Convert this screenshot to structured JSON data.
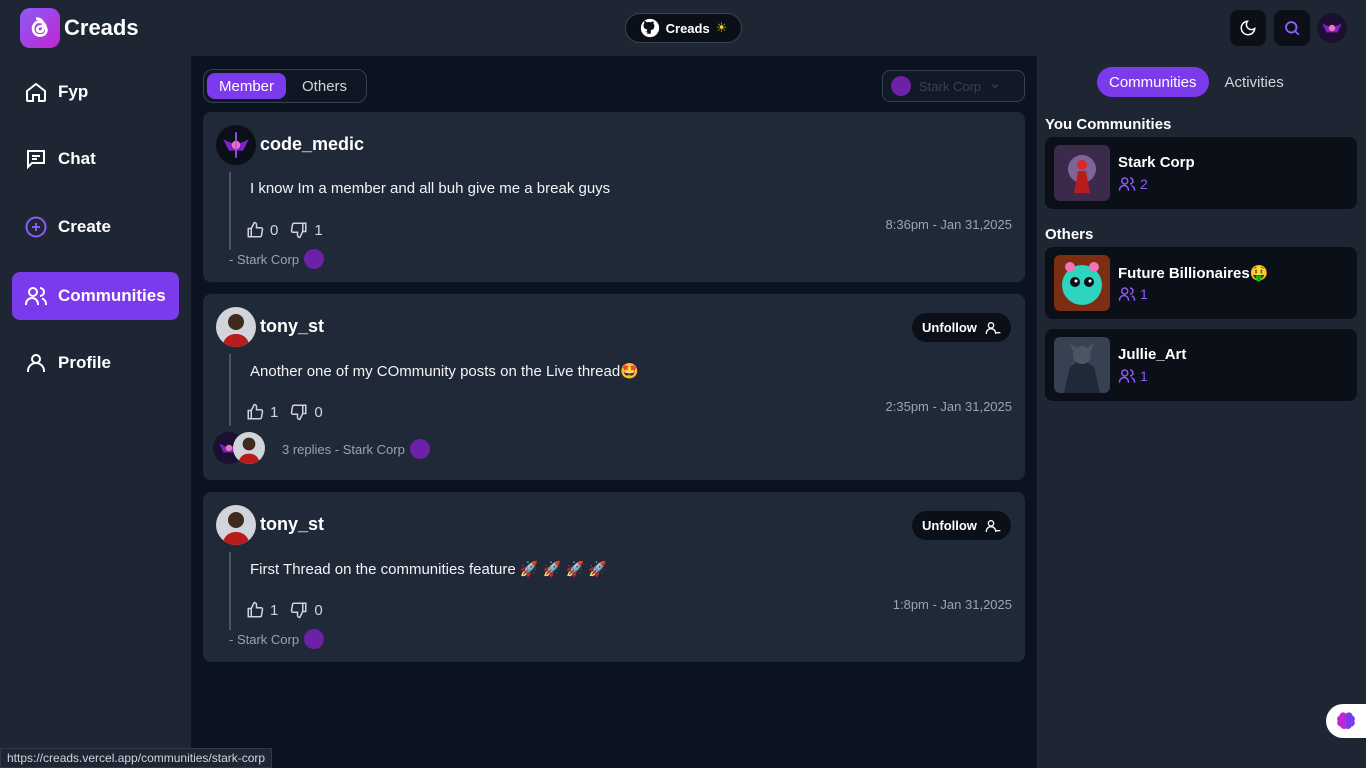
{
  "app": {
    "name": "Creads"
  },
  "header": {
    "github_pill": "Creads",
    "sun_glyph": "☀"
  },
  "nav": {
    "items": [
      {
        "label": "Fyp",
        "icon": "home-icon"
      },
      {
        "label": "Chat",
        "icon": "chat-icon"
      },
      {
        "label": "Create",
        "icon": "plus-circle-icon"
      },
      {
        "label": "Communities",
        "icon": "users-icon",
        "active": true
      },
      {
        "label": "Profile",
        "icon": "user-icon"
      }
    ]
  },
  "main": {
    "tabs": [
      {
        "label": "Member",
        "active": true
      },
      {
        "label": "Others",
        "active": false
      }
    ],
    "community_select": "Stark Corp",
    "posts": [
      {
        "username": "code_medic",
        "text": "I know Im a member and all buh give me a break guys",
        "likes": "0",
        "dislikes": "1",
        "time": "8:36pm - Jan 31,2025",
        "meta": "- Stark Corp",
        "unfollow": ""
      },
      {
        "username": "tony_st",
        "text": "Another one of my COmmunity posts on the Live thread🤩",
        "likes": "1",
        "dislikes": "0",
        "time": "2:35pm - Jan 31,2025",
        "meta": "3 replies - Stark Corp",
        "unfollow": "Unfollow"
      },
      {
        "username": "tony_st",
        "text": "First Thread on the communities feature 🚀 🚀 🚀 🚀",
        "likes": "1",
        "dislikes": "0",
        "time": "1:8pm - Jan 31,2025",
        "meta": "- Stark Corp",
        "unfollow": "Unfollow"
      }
    ]
  },
  "right": {
    "tabs": [
      {
        "label": "Communities",
        "active": true
      },
      {
        "label": "Activities",
        "active": false
      }
    ],
    "your_title": "You Communities",
    "others_title": "Others",
    "your_communities": [
      {
        "name": "Stark Corp",
        "members": "2"
      }
    ],
    "other_communities": [
      {
        "name": "Future Billionaires🤑",
        "members": "1"
      },
      {
        "name": "Jullie_Art",
        "members": "1"
      }
    ]
  },
  "status_bar": {
    "url": "https://creads.vercel.app/communities/stark-corp"
  },
  "colors": {
    "accent": "#7c3aed",
    "bg": "#0b1220",
    "panel": "#1e2533",
    "card": "#1f2937"
  }
}
